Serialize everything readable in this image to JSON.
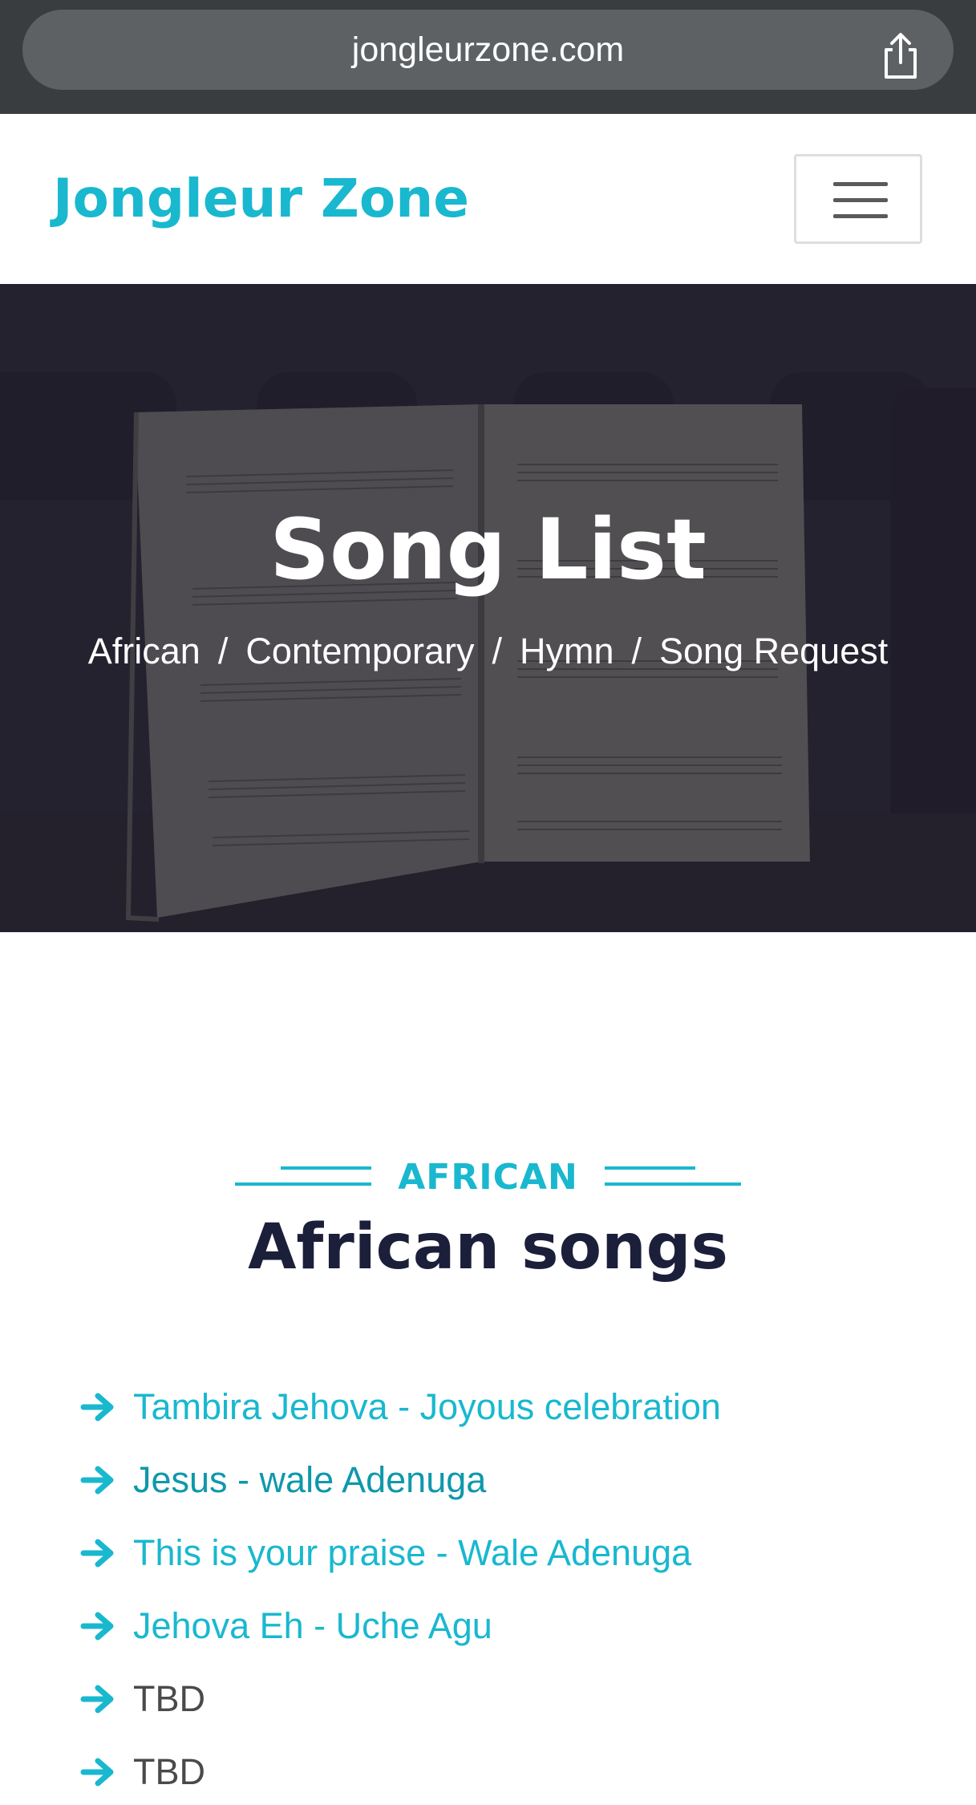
{
  "browser": {
    "url": "jongleurzone.com",
    "share_icon": "share-icon"
  },
  "header": {
    "brand": "Jongleur Zone",
    "menu_icon": "hamburger-menu-icon"
  },
  "hero": {
    "title": "Song List",
    "breadcrumbs": [
      "African",
      "Contemporary",
      "Hymn",
      "Song Request"
    ],
    "separator": "/"
  },
  "section": {
    "tag": "AFRICAN",
    "heading": "African songs"
  },
  "songs": [
    {
      "title": "Tambira Jehova - Joyous celebration",
      "style": "link"
    },
    {
      "title": "Jesus - wale Adenuga",
      "style": "visited"
    },
    {
      "title": "This is your praise - Wale Adenuga",
      "style": "link"
    },
    {
      "title": "Jehova Eh - Uche Agu",
      "style": "link"
    },
    {
      "title": "TBD",
      "style": "plain"
    },
    {
      "title": "TBD",
      "style": "plain"
    }
  ],
  "colors": {
    "accent": "#19b8cf",
    "heading": "#1b1f3a",
    "hero_overlay": "#2a2632"
  }
}
